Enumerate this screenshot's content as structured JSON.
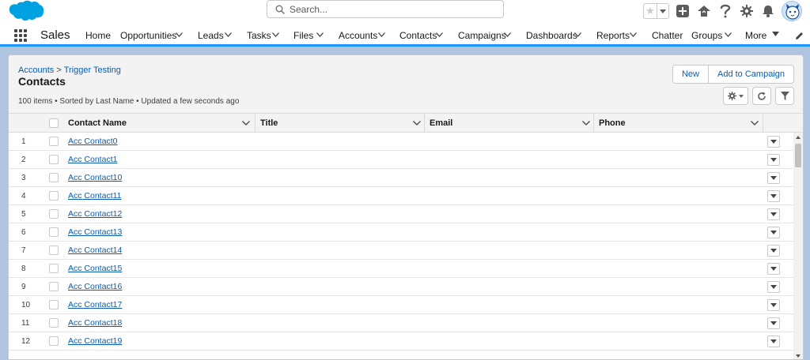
{
  "header": {
    "search_placeholder": "Search..."
  },
  "nav": {
    "app_name": "Sales",
    "items": [
      {
        "label": "Home",
        "has_menu": false
      },
      {
        "label": "Opportunities",
        "has_menu": true
      },
      {
        "label": "Leads",
        "has_menu": true
      },
      {
        "label": "Tasks",
        "has_menu": true
      },
      {
        "label": "Files",
        "has_menu": true
      },
      {
        "label": "Accounts",
        "has_menu": true
      },
      {
        "label": "Contacts",
        "has_menu": true
      },
      {
        "label": "Campaigns",
        "has_menu": true
      },
      {
        "label": "Dashboards",
        "has_menu": true
      },
      {
        "label": "Reports",
        "has_menu": true
      },
      {
        "label": "Chatter",
        "has_menu": false
      },
      {
        "label": "Groups",
        "has_menu": true
      },
      {
        "label": "More",
        "has_menu": true
      }
    ]
  },
  "list": {
    "breadcrumb": [
      "Accounts",
      "Trigger Testing"
    ],
    "breadcrumb_sep": ">",
    "title": "Contacts",
    "meta": "100 items • Sorted by Last Name • Updated a few seconds ago",
    "buttons": {
      "new": "New",
      "add_to_campaign": "Add to Campaign"
    },
    "columns": [
      "Contact Name",
      "Title",
      "Email",
      "Phone"
    ],
    "rows": [
      {
        "num": "1",
        "name": "Acc Contact0"
      },
      {
        "num": "2",
        "name": "Acc Contact1"
      },
      {
        "num": "3",
        "name": "Acc Contact10"
      },
      {
        "num": "4",
        "name": "Acc Contact11"
      },
      {
        "num": "5",
        "name": "Acc Contact12"
      },
      {
        "num": "6",
        "name": "Acc Contact13"
      },
      {
        "num": "7",
        "name": "Acc Contact14"
      },
      {
        "num": "8",
        "name": "Acc Contact15"
      },
      {
        "num": "9",
        "name": "Acc Contact16"
      },
      {
        "num": "10",
        "name": "Acc Contact17"
      },
      {
        "num": "11",
        "name": "Acc Contact18"
      },
      {
        "num": "12",
        "name": "Acc Contact19"
      }
    ]
  },
  "colors": {
    "brand_blue": "#00a1e0",
    "link_blue": "#0b5cab",
    "nav_accent": "#1b96ff",
    "page_background": "#b0c4df"
  },
  "icons": [
    "salesforce-cloud-icon",
    "search-icon",
    "star-icon",
    "plus-icon",
    "trailhead-icon",
    "help-icon",
    "gear-icon",
    "bell-icon",
    "avatar-icon",
    "app-launcher-icon",
    "pencil-icon",
    "refresh-icon",
    "filter-icon",
    "chevron-down-icon"
  ]
}
